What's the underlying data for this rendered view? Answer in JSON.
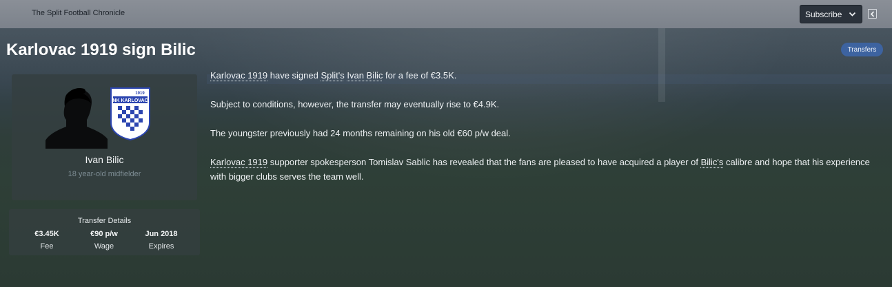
{
  "header": {
    "publication": "The Split Football Chronicle",
    "subscribe_label": "Subscribe"
  },
  "article": {
    "title": "Karlovac 1919 sign Bilic",
    "tag": "Transfers",
    "p1": {
      "club": "Karlovac 1919",
      "t1": " have signed ",
      "from_club": "Split's",
      "t2": " ",
      "player": "Ivan Bilic",
      "t3": " for a fee of €3.5K."
    },
    "p2": "Subject to conditions, however, the transfer may eventually rise to €4.9K.",
    "p3": "The youngster previously had 24 months remaining on his old €60 p/w deal.",
    "p4": {
      "club": "Karlovac 1919",
      "t1": " supporter spokesperson Tomislav Sablic has revealed that the fans are pleased to have acquired a player of ",
      "player": "Bilic's",
      "t2": " calibre and hope that his experience with bigger clubs serves the team well."
    }
  },
  "player_card": {
    "name": "Ivan Bilic",
    "description": "18 year-old midfielder",
    "crest_text": "NK KARLOVAC",
    "crest_year": "1919"
  },
  "transfer_details": {
    "title": "Transfer Details",
    "items": [
      {
        "value": "€3.45K",
        "label": "Fee"
      },
      {
        "value": "€90 p/w",
        "label": "Wage"
      },
      {
        "value": "Jun 2018",
        "label": "Expires"
      }
    ]
  },
  "icons": {
    "subscribe_dropdown": "chevron-down-icon",
    "collapse": "chevron-left-icon",
    "player": "player-silhouette-icon",
    "club": "club-crest-icon"
  },
  "colors": {
    "accent_tag": "#3d63a0",
    "topbar": "#7c828b",
    "card": "#343e40"
  }
}
